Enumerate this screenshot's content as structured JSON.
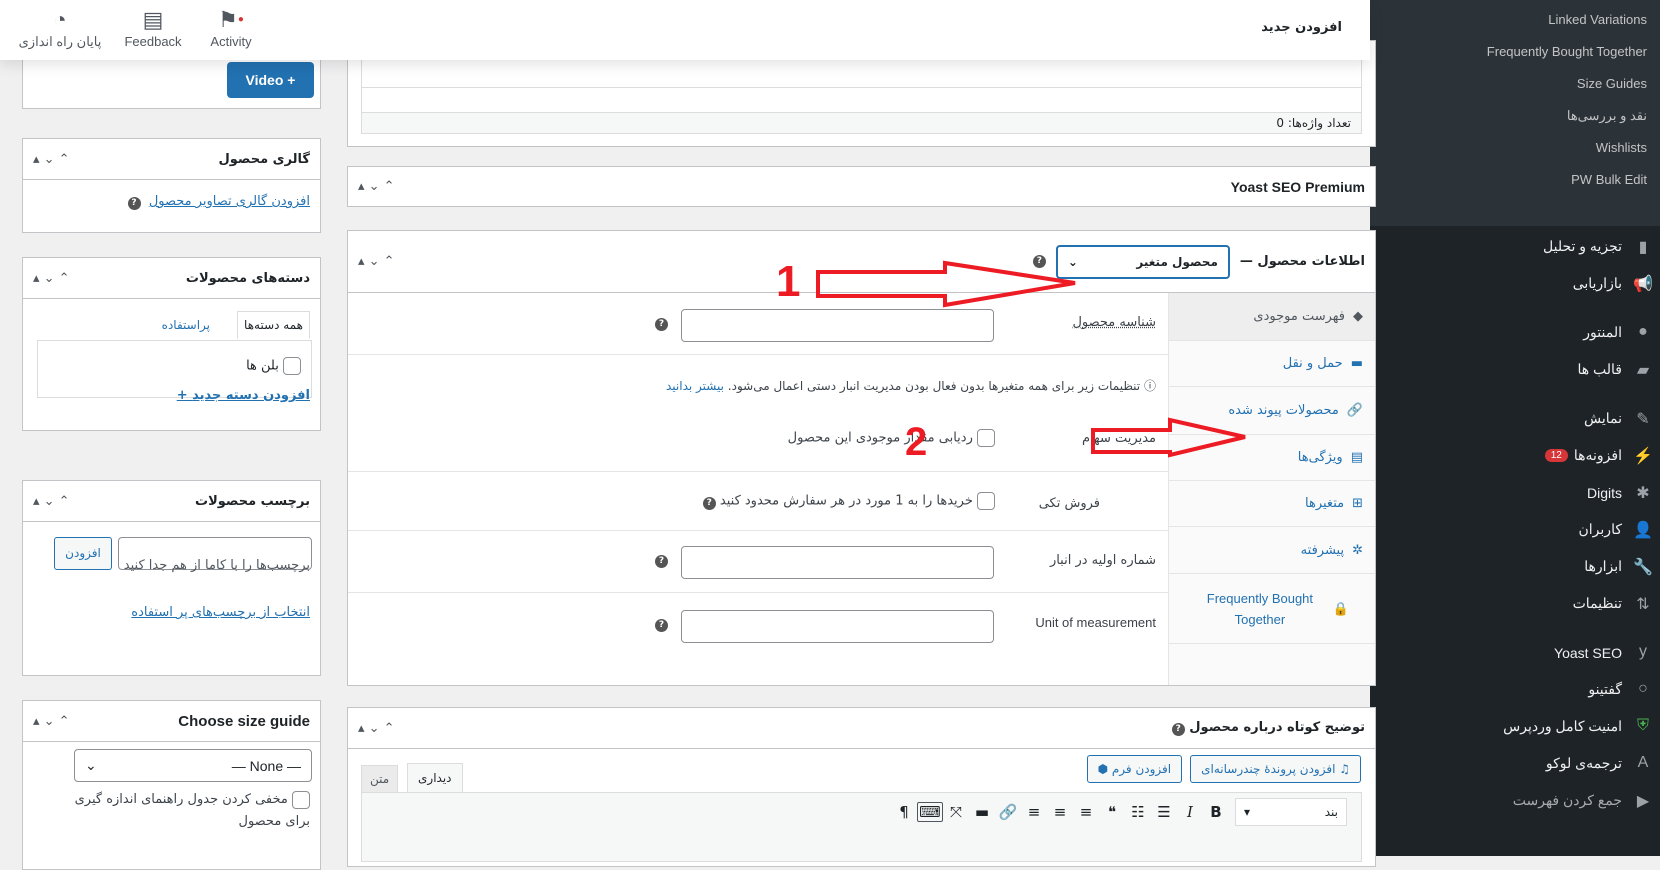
{
  "topbar": {
    "page_title": "افزودن جدید",
    "buttons": [
      {
        "label": "پایان راه اندازی",
        "icon": "pie-icon"
      },
      {
        "label": "Feedback",
        "icon": "feedback-icon"
      },
      {
        "label": "Activity",
        "icon": "flag-icon"
      }
    ]
  },
  "sidebar": {
    "submenu": [
      "Linked Variations",
      "Frequently Bought Together",
      "Size Guides",
      "نقد و بررسی‌ها",
      "Wishlists",
      "PW Bulk Edit"
    ],
    "menu": [
      {
        "label": "تجزیه و تحلیل",
        "icon": "bar-chart-icon"
      },
      {
        "label": "بازاریابی",
        "icon": "megaphone-icon"
      },
      {
        "label": "المنتور",
        "icon": "elementor-icon"
      },
      {
        "label": "قالب ها",
        "icon": "folder-icon"
      },
      {
        "label": "نمایش",
        "icon": "brush-icon"
      },
      {
        "label": "افزونه‌ها",
        "icon": "plugin-icon",
        "badge": "12"
      },
      {
        "label": "Digits",
        "icon": "asterisk-icon"
      },
      {
        "label": "کاربران",
        "icon": "user-icon"
      },
      {
        "label": "ابزارها",
        "icon": "wrench-icon"
      },
      {
        "label": "تنظیمات",
        "icon": "settings-icon"
      },
      {
        "label": "Yoast SEO",
        "icon": "yoast-icon"
      },
      {
        "label": "گفتینو",
        "icon": "chat-icon"
      },
      {
        "label": "امنیت کامل وردپرس",
        "icon": "shield-icon"
      },
      {
        "label": "ترجمه‌ی لوکو",
        "icon": "translate-icon"
      },
      {
        "label": "جمع کردن فهرست",
        "icon": "collapse-icon"
      }
    ]
  },
  "editor": {
    "word_count": "تعداد واژه‌ها: 0"
  },
  "yoast": {
    "title": "Yoast SEO Premium"
  },
  "product_data": {
    "title": "اطلاعات محصول —",
    "type_value": "محصول متغیر",
    "tabs": [
      {
        "label": "فهرست موجودی",
        "icon": "tag-icon"
      },
      {
        "label": "حمل و نقل",
        "icon": "truck-icon"
      },
      {
        "label": "محصولات پیوند شده",
        "icon": "link-icon"
      },
      {
        "label": "ویژگی‌ها",
        "icon": "list-icon"
      },
      {
        "label": "متغیرها",
        "icon": "grid-icon"
      },
      {
        "label": "پیشرفته",
        "icon": "gear-icon"
      },
      {
        "label": "Frequently Bought Together",
        "icon": "bag-icon"
      }
    ],
    "sku_label": "شناسه محصول",
    "notice": "تنظیمات زیر برای همه متغیرها بدون فعال بودن مدیریت انبار دستی اعمال می‌شود.",
    "notice_link": "بیشتر بدانید",
    "manage_stock_label": "مدیریت سهام",
    "manage_stock_text": "ردیابی مقدار موجودی این محصول",
    "sold_individually_label": "فروش تکی",
    "sold_individually_text": "خریدها را به 1 مورد در هر سفارش محدود کنید",
    "stock_qty_label": "شماره اولیه در انبار",
    "unit_label": "Unit of measurement"
  },
  "annotations": {
    "one": "1",
    "two": "2",
    "color": "#ed1c24"
  },
  "short_desc": {
    "title": "توضیح کوتاه درباره محصول",
    "add_media": "افزودن پروندهٔ چندرسانه‌ای",
    "add_form": "افزودن فرم",
    "tab_visual": "دیداری",
    "tab_text": "متن",
    "format": "بند"
  },
  "left": {
    "video_btn": "Video +",
    "gallery": {
      "title": "گالری محصول",
      "link": "افزودن گالری تصاویر محصول"
    },
    "categories": {
      "title": "دسته‌های محصولات",
      "tab_all": "همه دسته‌ها",
      "tab_popular": "پراستفاده",
      "item": "بلن ها",
      "add_link": "+ افزودن دسته جدید"
    },
    "tags": {
      "title": "برچسب محصولات",
      "add_btn": "افزودن",
      "hint": "برچسب‌ها را با کاما از هم جدا کنید",
      "link": "انتخاب از برچسب‌های پر استفاده"
    },
    "size_guide": {
      "title": "Choose size guide",
      "select": "— None —",
      "hide_label": "مخفی کردن جدول راهنمای اندازه گیری برای محصول"
    }
  }
}
